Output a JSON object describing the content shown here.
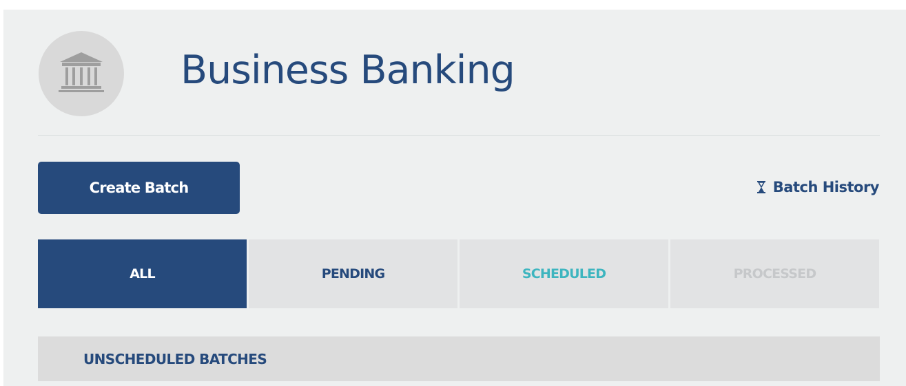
{
  "header": {
    "title": "Business Banking",
    "avatar_icon": "bank-icon"
  },
  "actions": {
    "create_batch_label": "Create Batch",
    "history_label": "Batch History",
    "history_icon": "hourglass-icon"
  },
  "tabs": [
    {
      "label": "ALL",
      "state": "active"
    },
    {
      "label": "PENDING",
      "state": "normal"
    },
    {
      "label": "SCHEDULED",
      "state": "normal"
    },
    {
      "label": "PROCESSED",
      "state": "disabled"
    }
  ],
  "section": {
    "title": "UNSCHEDULED BATCHES"
  },
  "colors": {
    "brand": "#264a7c",
    "scheduled": "#3db5bf",
    "disabled": "#c6c8ca",
    "background": "#eef0f0"
  }
}
